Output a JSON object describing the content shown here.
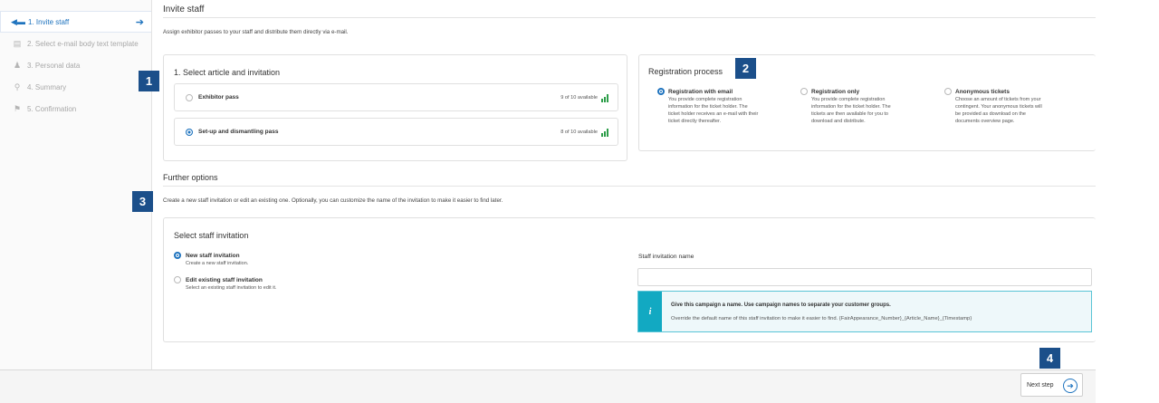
{
  "sidebar": {
    "steps": [
      {
        "label": "1. Invite staff",
        "icon": "megaphone-icon",
        "glyph": "◀▬",
        "active": true
      },
      {
        "label": "2. Select e-mail body text template",
        "icon": "chat-icon",
        "glyph": "▤"
      },
      {
        "label": "3. Personal data",
        "icon": "users-icon",
        "glyph": "♟"
      },
      {
        "label": "4. Summary",
        "icon": "search-icon",
        "glyph": "⚲"
      },
      {
        "label": "5. Confirmation",
        "icon": "flag-icon",
        "glyph": "⚑"
      }
    ],
    "active_arrow": "➔"
  },
  "main": {
    "title": "Invite staff",
    "subtitle": "Assign exhibitor passes to your staff and distribute them directly via e-mail."
  },
  "articles": {
    "title": "1. Select article and invitation",
    "items": [
      {
        "label": "Exhibitor pass",
        "availability": "9 of 10 available",
        "selected": false
      },
      {
        "label": "Set-up and dismantling pass",
        "availability": "8 of 10 available",
        "selected": true
      }
    ]
  },
  "registration": {
    "title": "Registration process",
    "options": [
      {
        "label": "Registration with email",
        "selected": true,
        "desc": [
          "You provide complete registration",
          "information for the ticket holder. The",
          "ticket holder receives an e-mail with their",
          "ticket directly thereafter."
        ]
      },
      {
        "label": "Registration only",
        "selected": false,
        "desc": [
          "You provide complete registration",
          "information for the ticket holder. The",
          "tickets are then available for you to",
          "download and distribute."
        ]
      },
      {
        "label": "Anonymous tickets",
        "selected": false,
        "desc": [
          "Choose an amount of tickets from your",
          "contingent. Your anonymous tickets will",
          "be provided as download on the",
          "documents overview page."
        ]
      }
    ]
  },
  "further": {
    "title": "Further options",
    "desc": "Create a new staff invitation or edit an existing one. Optionally, you can customize the name of the invitation to make it easier to find later.",
    "panel_title": "Select staff invitation",
    "options": [
      {
        "label": "New staff invitation",
        "desc": "Create a new staff invitation.",
        "selected": true
      },
      {
        "label": "Edit existing staff invitation",
        "desc": "Select an existing staff invitation to edit it.",
        "selected": false
      }
    ],
    "name_label": "Staff invitation name",
    "name_value": "",
    "info_line1": "Give this campaign a name. Use campaign names to separate your customer groups.",
    "info_line2": "Override the default name of this staff invitation to make it easier to find. {FairAppearance_Number}_{Article_Name}_{Timestamp}",
    "info_glyph": "i"
  },
  "badges": [
    "1",
    "2",
    "3",
    "4"
  ],
  "footer": {
    "next_label": "Next step",
    "next_glyph": "➔"
  },
  "colors": {
    "accent": "#1e73be",
    "badge": "#1b4f8a",
    "info": "#12a9c2",
    "available": "#2e9e4a"
  }
}
